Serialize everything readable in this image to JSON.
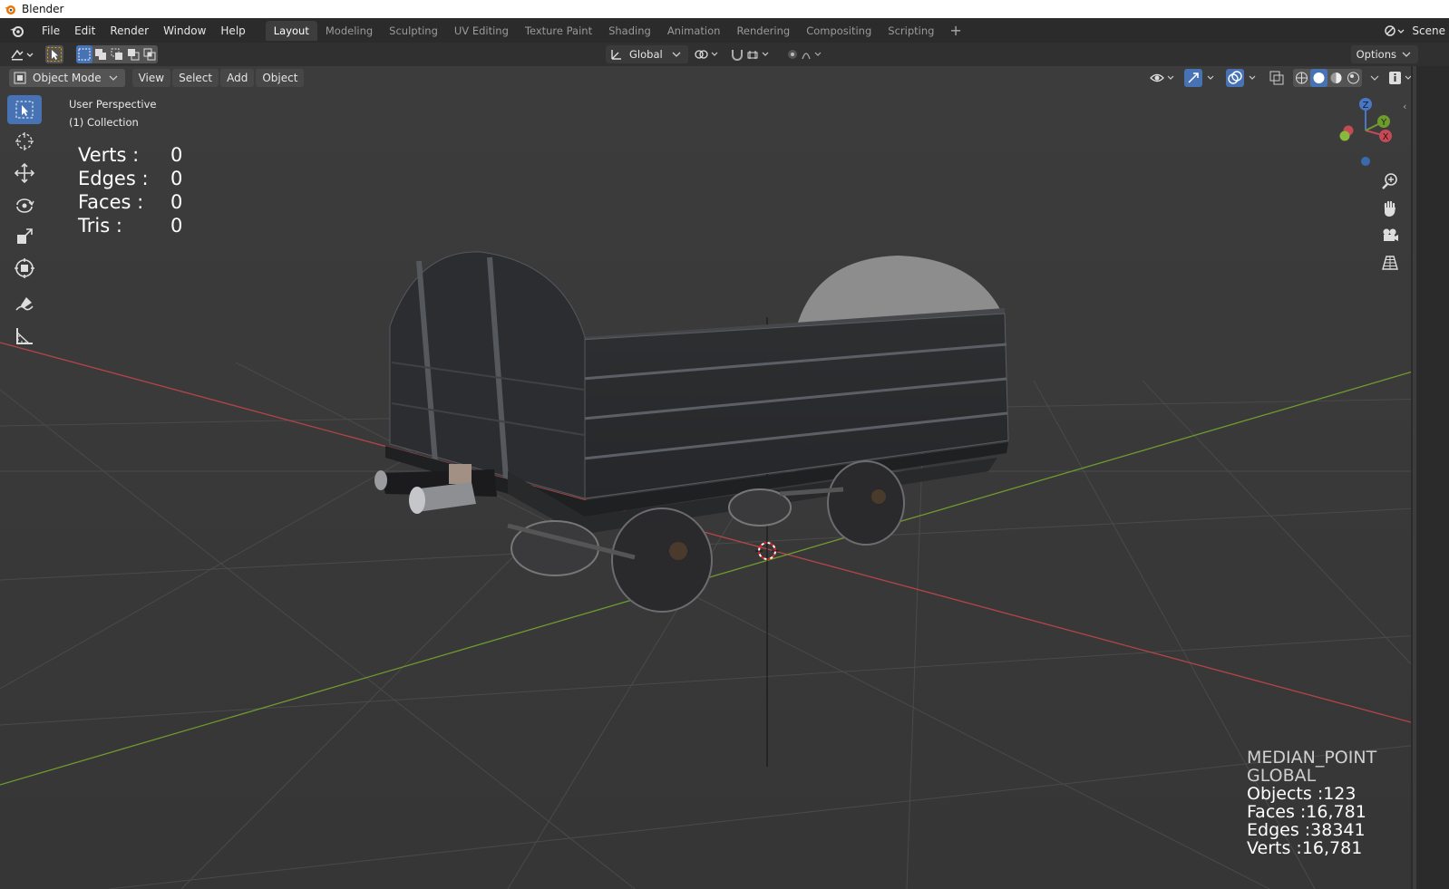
{
  "window": {
    "title": "Blender"
  },
  "menubar": {
    "items": [
      "File",
      "Edit",
      "Render",
      "Window",
      "Help"
    ],
    "workspaces": [
      "Layout",
      "Modeling",
      "Sculpting",
      "UV Editing",
      "Texture Paint",
      "Shading",
      "Animation",
      "Rendering",
      "Compositing",
      "Scripting"
    ],
    "active_workspace": "Layout",
    "add_label": "+",
    "scene_label": "Scene"
  },
  "tool_header": {
    "orientation": "Global",
    "options_label": "Options"
  },
  "viewport_header": {
    "mode": "Object Mode",
    "menus": [
      "View",
      "Select",
      "Add",
      "Object"
    ]
  },
  "overlay": {
    "view_name": "User Perspective",
    "collection": "(1) Collection",
    "stats": [
      {
        "label": "Verts :",
        "value": "0"
      },
      {
        "label": "Edges :",
        "value": "0"
      },
      {
        "label": "Faces :",
        "value": "0"
      },
      {
        "label": "Tris :",
        "value": "0"
      }
    ]
  },
  "scene_stats": {
    "pivot": "MEDIAN_POINT",
    "orientation": "GLOBAL",
    "objects": "Objects :123",
    "faces": "Faces :16,781",
    "edges": "Edges :38341",
    "verts": "Verts :16,781"
  },
  "gizmo": {
    "z_label": "Z",
    "x_label": "X",
    "y_label": "Y"
  },
  "colors": {
    "accent": "#4772b3",
    "x_axis": "#b5444a",
    "y_axis": "#6f9a2e",
    "viewport_bg": "#393939"
  },
  "icons": {
    "toolbar": [
      "select-box-icon",
      "cursor-icon",
      "move-icon",
      "rotate-icon",
      "scale-icon",
      "transform-icon",
      "annotate-icon",
      "measure-icon"
    ],
    "nav": [
      "zoom-icon",
      "pan-hand-icon",
      "camera-icon",
      "grid-icon"
    ]
  }
}
